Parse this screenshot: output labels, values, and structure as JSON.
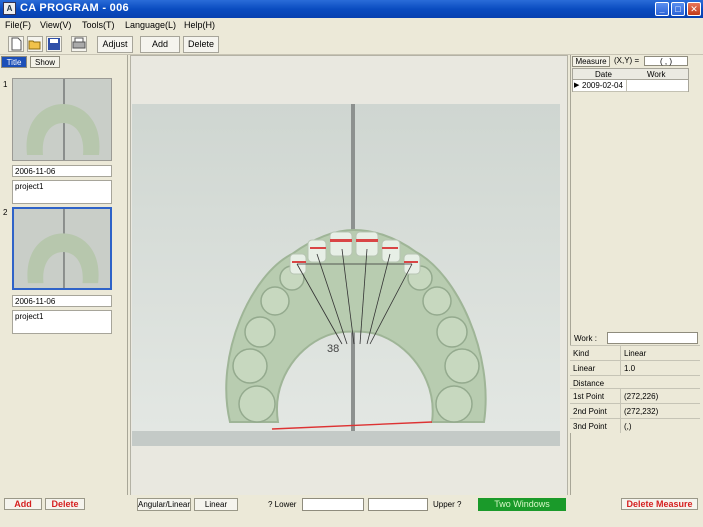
{
  "window": {
    "title": "CA PROGRAM - 006",
    "app_icon": "A"
  },
  "caption_buttons": {
    "minimize": "_",
    "maximize": "□",
    "close": "✕"
  },
  "menu": [
    {
      "label": "File(F)"
    },
    {
      "label": "View(V)"
    },
    {
      "label": "Tools(T)"
    },
    {
      "label": "Language(L)"
    },
    {
      "label": "Help(H)"
    }
  ],
  "toolbar": {
    "icons": [
      "new-file-icon",
      "open-folder-icon",
      "save-icon",
      "print-icon"
    ],
    "adjust_label": "Adjust",
    "add_label": "Add",
    "delete_label": "Delete"
  },
  "left_panel": {
    "tabs": {
      "title": "Title",
      "show": "Show"
    },
    "items": [
      {
        "index": "1",
        "date": "2006-11-06",
        "project": "project1"
      },
      {
        "index": "2",
        "date": "2006-11-06",
        "project": "project1"
      }
    ],
    "add_label": "Add",
    "delete_label": "Delete"
  },
  "right_panel": {
    "measure_tab": "Measure",
    "xy_label": "(X,Y) =",
    "xy_value": "(        ,       )",
    "grid": {
      "columns": [
        "Date",
        "Work"
      ],
      "rows": [
        {
          "date": "2009-02-04",
          "work": ""
        }
      ]
    },
    "work_label": "Work :",
    "work_value": "",
    "properties": [
      {
        "key": "Kind",
        "value": "Linear"
      },
      {
        "key": "Linear",
        "value": "1.0"
      },
      {
        "key": "Distance",
        "value": ""
      },
      {
        "key": "1st Point",
        "value": "(272,226)"
      },
      {
        "key": "2nd Point",
        "value": "(272,232)"
      },
      {
        "key": "3nd Point",
        "value": "(,)"
      }
    ],
    "delete_measure_label": "Delete Measure"
  },
  "bottom_bar": {
    "angular_linear_label": "Angular/Linear",
    "linear_label": "Linear",
    "lower_label": "? Lower",
    "upper_label": "Upper ?",
    "two_windows_label": "Two Windows"
  },
  "photo": {
    "annotation_text": "38"
  }
}
